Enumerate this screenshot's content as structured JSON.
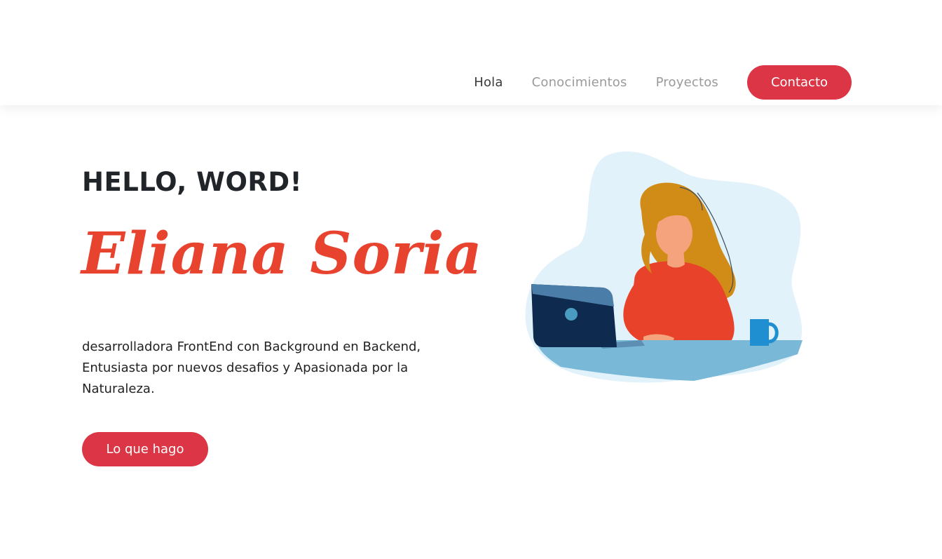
{
  "nav": {
    "items": [
      {
        "label": "Hola",
        "active": true
      },
      {
        "label": "Conocimientos",
        "active": false
      },
      {
        "label": "Proyectos",
        "active": false
      }
    ],
    "contact_label": "Contacto"
  },
  "hero": {
    "greeting": "HELLO, WORD!",
    "name": "Eliana Soria",
    "description_lines": [
      "desarrolladora FrontEnd con Background en Backend,",
      "Entusiasta por nuevos desafios y Apasionada por la",
      "Naturaleza."
    ],
    "cta_label": "Lo que hago"
  },
  "colors": {
    "accent": "#dc3545",
    "name": "#e8432f",
    "text": "#212529",
    "blob": "#e1f2fb",
    "desk": "#79b8d6",
    "laptop": "#0e2a4f",
    "sweater": "#e8432a",
    "hair": "#d08c16",
    "skin": "#f4a37c",
    "mug": "#1f8fd1"
  },
  "illustration": {
    "icon": "woman-working-on-laptop-illustration"
  }
}
